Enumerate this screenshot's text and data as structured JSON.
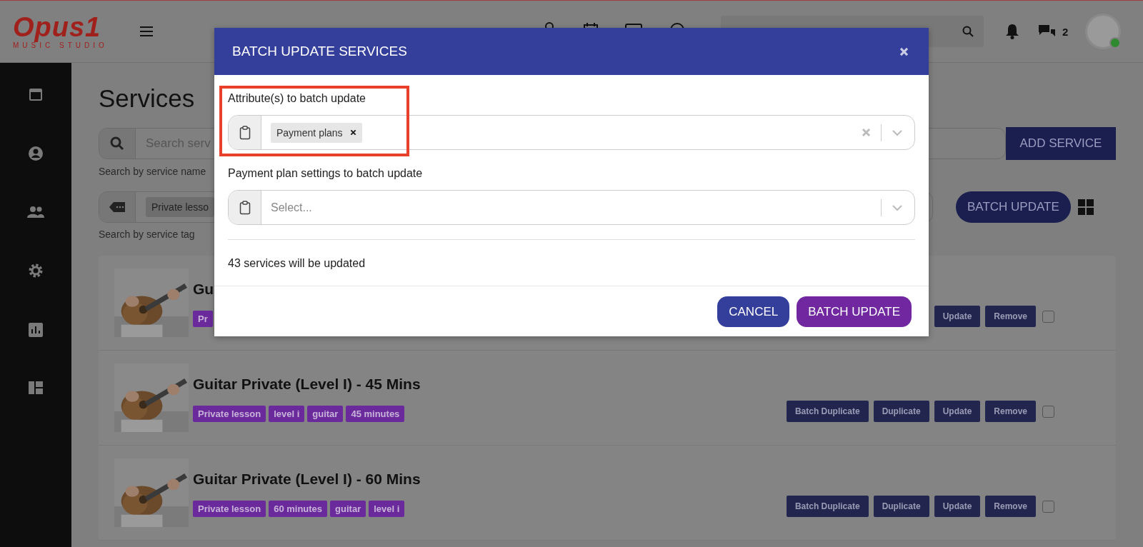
{
  "header": {
    "logo": "Opus1",
    "logo_subtitle": "MUSIC STUDIO",
    "message_count": "2",
    "online": true
  },
  "page": {
    "title": "Services",
    "search": {
      "placeholder": "Search serv",
      "hint": "Search by service name"
    },
    "add_button": "ADD SERVICE",
    "tag_filter": {
      "chips": [
        "Private lesso"
      ],
      "hint": "Search by service tag"
    },
    "batch_button": "BATCH UPDATE"
  },
  "services": [
    {
      "title": "Gu",
      "tags": [
        "Pr"
      ],
      "buttons": [
        "Update",
        "Remove"
      ],
      "checked": false
    },
    {
      "title": "Guitar Private (Level I) - 45 Mins",
      "tags": [
        "Private lesson",
        "level i",
        "guitar",
        "45 minutes"
      ],
      "buttons": [
        "Batch Duplicate",
        "Duplicate",
        "Update",
        "Remove"
      ],
      "checked": false
    },
    {
      "title": "Guitar Private (Level I) - 60 Mins",
      "tags": [
        "Private lesson",
        "60 minutes",
        "guitar",
        "level i"
      ],
      "buttons": [
        "Batch Duplicate",
        "Duplicate",
        "Update",
        "Remove"
      ],
      "checked": false
    }
  ],
  "modal": {
    "title": "BATCH UPDATE SERVICES",
    "fields": [
      {
        "label": "Attribute(s) to batch update",
        "chips": [
          "Payment plans"
        ],
        "highlighted": true
      },
      {
        "label": "Payment plan settings to batch update",
        "placeholder": "Select...",
        "highlighted": false
      }
    ],
    "summary": "43 services will be updated",
    "buttons": [
      {
        "label": "CANCEL",
        "kind": "secondary"
      },
      {
        "label": "BATCH UPDATE",
        "kind": "primary"
      }
    ]
  }
}
